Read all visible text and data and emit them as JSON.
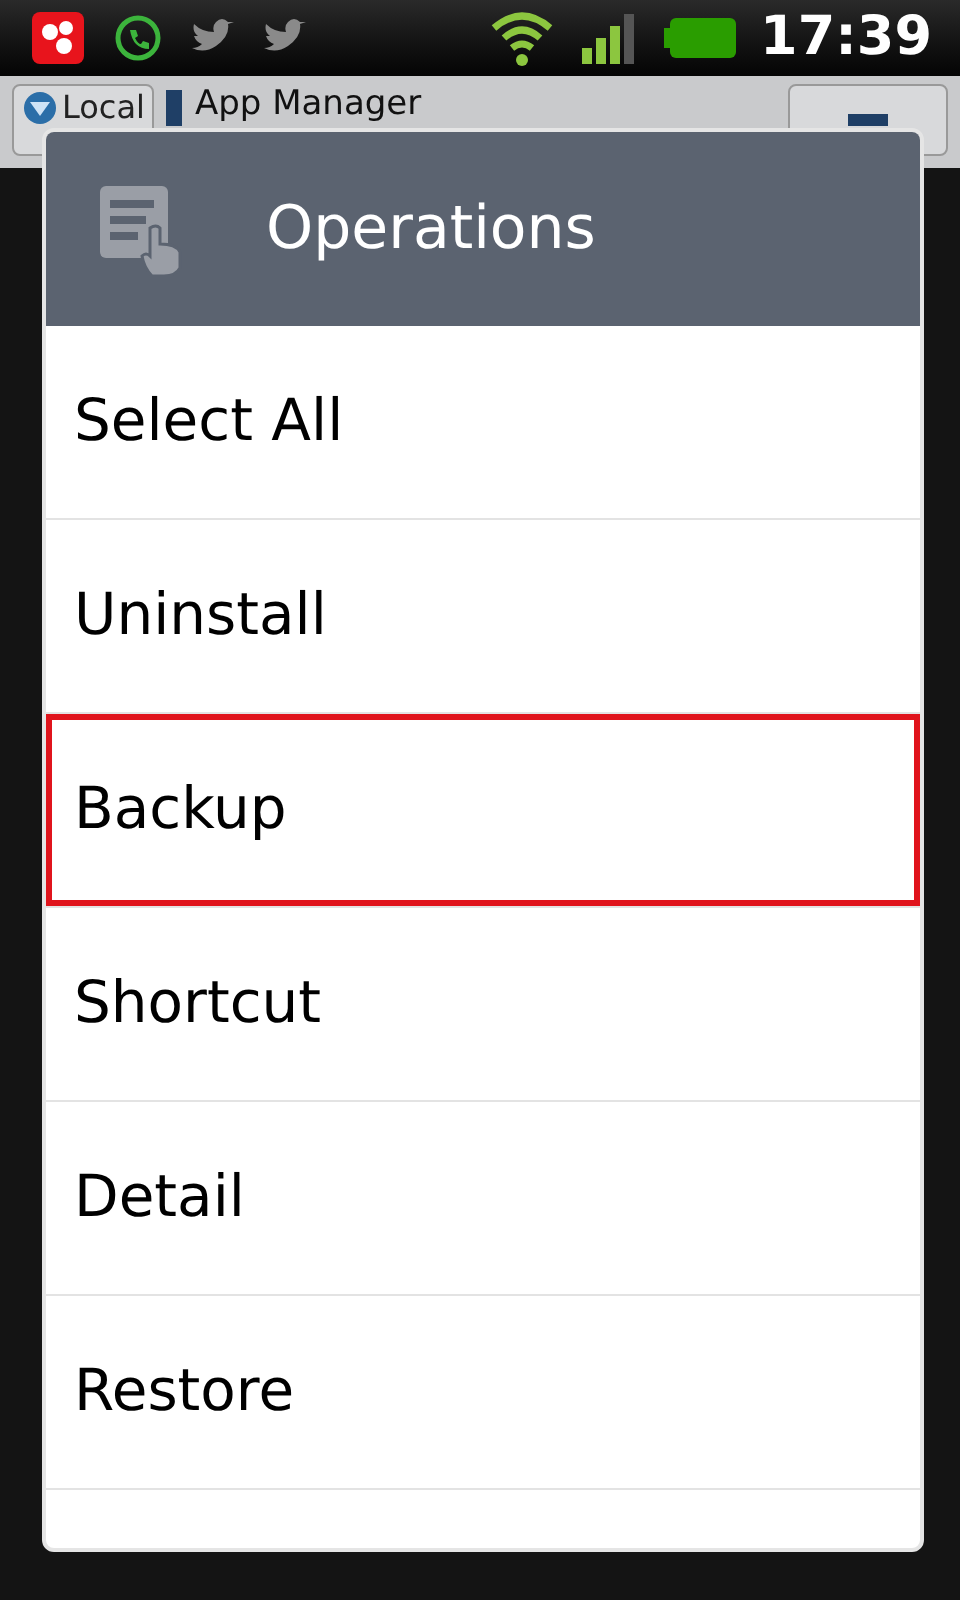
{
  "status_bar": {
    "time": "17:39"
  },
  "app_bar": {
    "location_button": "Local",
    "title": "App Manager"
  },
  "dialog": {
    "title": "Operations",
    "items": [
      {
        "label": "Select All",
        "selected": false
      },
      {
        "label": "Uninstall",
        "selected": false
      },
      {
        "label": "Backup",
        "selected": true
      },
      {
        "label": "Shortcut",
        "selected": false
      },
      {
        "label": "Detail",
        "selected": false
      },
      {
        "label": "Restore",
        "selected": false
      }
    ]
  }
}
